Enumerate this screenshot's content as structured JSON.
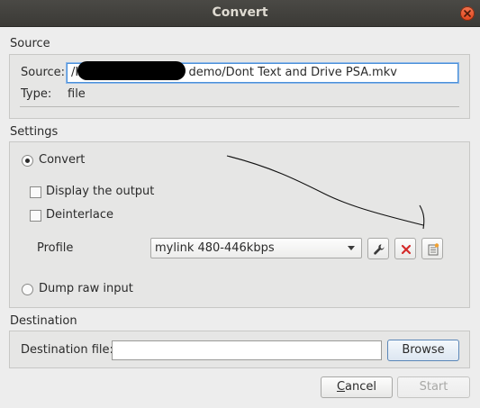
{
  "window": {
    "title": "Convert"
  },
  "source": {
    "section_label": "Source",
    "field_label": "Source:",
    "field_value_prefix": "/H",
    "field_value_suffix": "demo/Dont Text and Drive PSA.mkv",
    "type_label": "Type:",
    "type_value": "file"
  },
  "settings": {
    "section_label": "Settings",
    "convert_label": "Convert",
    "convert_selected": true,
    "display_output_label": "Display the output",
    "display_output_checked": false,
    "deinterlace_label": "Deinterlace",
    "deinterlace_checked": false,
    "profile_label": "Profile",
    "profile_value": "mylink  480-446kbps",
    "dump_raw_label": "Dump raw input",
    "dump_raw_selected": false
  },
  "destination": {
    "section_label": "Destination",
    "file_label": "Destination file:",
    "file_value": "",
    "browse_label": "Browse"
  },
  "buttons": {
    "cancel_mnemonic": "C",
    "cancel_rest": "ancel",
    "start_label": "Start"
  },
  "icons": {
    "close": "close-icon",
    "edit_profile": "wrench-icon",
    "delete_profile": "red-x-icon",
    "new_profile": "new-profile-icon"
  },
  "colors": {
    "titlebar": "#3b3a36",
    "close_button": "#e0451c",
    "delete_icon": "#d42a2a",
    "focus_border": "#4a90d9"
  }
}
